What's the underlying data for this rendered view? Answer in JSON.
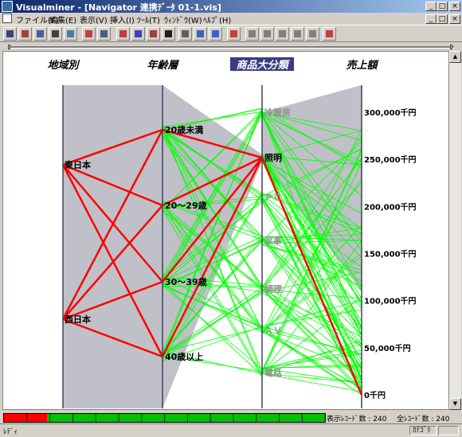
{
  "window": {
    "title": "Visualminer - [Navigator 連携ﾃﾞｰﾀ 01-1.vis]"
  },
  "menu": [
    "ファイル(F)",
    "編集(E)",
    "表示(V)",
    "挿入(I)",
    "ﾂｰﾙ(T)",
    "ｳｨﾝﾄﾞｳ(W)",
    "ﾍﾙﾌﾟ(H)"
  ],
  "toolbar": {
    "button_count": 21
  },
  "chart_data": {
    "type": "parallel_coordinates",
    "axes": [
      "地域別",
      "年齢層",
      "商品大分類",
      "売上額"
    ],
    "selected_axis": "商品大分類",
    "regions": [
      "東日本",
      "西日本"
    ],
    "age_groups": [
      "20歳未満",
      "20～29歳",
      "30～39歳",
      "40歳以上"
    ],
    "categories": [
      "冷暖房",
      "照明",
      "ＰＣ",
      "家事",
      "調理",
      "ＡＶ",
      "電話"
    ],
    "highlighted_category": "照明",
    "sales_ticks": [
      "300,000千円",
      "250,000千円",
      "200,000千円",
      "150,000千円",
      "100,000千円",
      "50,000千円",
      "0千円"
    ],
    "sales_range": [
      0,
      300000
    ],
    "unit": "千円",
    "colors": {
      "selected": "#ff0000",
      "records": "#00ff00",
      "band": "#c0c0c8",
      "axis": "#404060"
    }
  },
  "status": {
    "display_records": "表示ﾚｺｰﾄﾞ数 : 240",
    "total_records": "全ﾚｺｰﾄﾞ数 : 240",
    "ready": "ﾚﾃﾞｨ",
    "mode": "ｶﾃｺﾞﾘ"
  }
}
